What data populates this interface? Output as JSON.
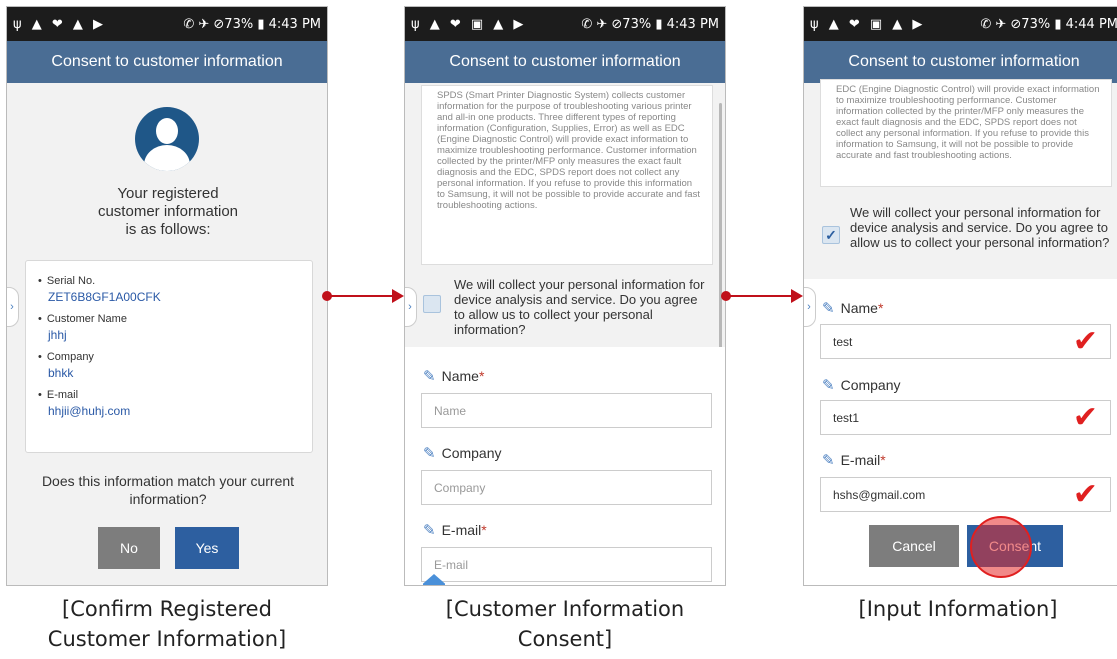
{
  "statusbars": {
    "p1": {
      "left": "ψ ▲ ❤ ▲ ▶",
      "right": "✆ ✈ ⊘73% ▮ 4:43 PM"
    },
    "p2": {
      "left": "ψ ▲ ❤ ▣ ▲ ▶",
      "right": "✆ ✈ ⊘73% ▮ 4:43 PM"
    },
    "p3": {
      "left": "ψ ▲ ❤ ▣ ▲ ▶",
      "right": "✆ ✈ ⊘73% ▮ 4:44 PM"
    }
  },
  "app_title": "Consent to customer information",
  "screen1": {
    "intro": [
      "Your registered",
      "customer information",
      "is as follows:"
    ],
    "fields": [
      {
        "label": "Serial No.",
        "value": "ZET6B8GF1A00CFK"
      },
      {
        "label": "Customer Name",
        "value": "jhhj"
      },
      {
        "label": "Company",
        "value": "bhkk"
      },
      {
        "label": "E-mail",
        "value": "hhjii@huhj.com"
      }
    ],
    "question": [
      "Does this information match your current",
      "information?"
    ],
    "no_label": "No",
    "yes_label": "Yes"
  },
  "screen2": {
    "policy": "SPDS (Smart Printer Diagnostic System) collects customer information for the purpose of troubleshooting various printer and all-in one products. Three different types of reporting information (Configuration, Supplies, Error) as well as EDC (Engine Diagnostic Control) will provide exact information to maximize troubleshooting performance. Customer information collected by the printer/MFP only measures the exact fault diagnosis and the EDC, SPDS report does not collect any personal information. If you refuse to provide this information to Samsung, it will not be possible to provide accurate and fast troubleshooting actions.",
    "consent": "We will collect your personal information for device analysis and service. Do you agree to allow us to collect your personal information?",
    "name_label": "Name",
    "company_label": "Company",
    "email_label": "E-mail",
    "required_mark": "*",
    "name_placeholder": "Name",
    "company_placeholder": "Company",
    "email_placeholder": "E-mail"
  },
  "screen3": {
    "policy": "EDC (Engine Diagnostic Control) will provide exact information to maximize troubleshooting performance. Customer information collected by the printer/MFP only measures the exact fault diagnosis and the EDC, SPDS report does not collect any personal information. If you refuse to provide this information to Samsung, it will not be possible to provide accurate and fast troubleshooting actions.",
    "consent": "We will collect your personal information for device analysis and service. Do you agree to allow us to collect your personal information?",
    "name_label": "Name",
    "company_label": "Company",
    "email_label": "E-mail",
    "required_mark": "*",
    "name_value": "test",
    "company_value": "test1",
    "email_value": "hshs@gmail.com",
    "cancel_label": "Cancel",
    "consent_label": "Consent",
    "check_glyph": "✔"
  },
  "captions": {
    "c1": [
      "[Confirm Registered",
      "Customer Information]"
    ],
    "c2": [
      "[Customer Information",
      "Consent]"
    ],
    "c3": [
      "[Input Information]"
    ]
  },
  "colors": {
    "appbar": "#4a6d94",
    "primary_button": "#2d5fa0",
    "secondary_button": "#7d7d7d",
    "arrow": "#c0101a",
    "checkmark": "#e02020"
  }
}
